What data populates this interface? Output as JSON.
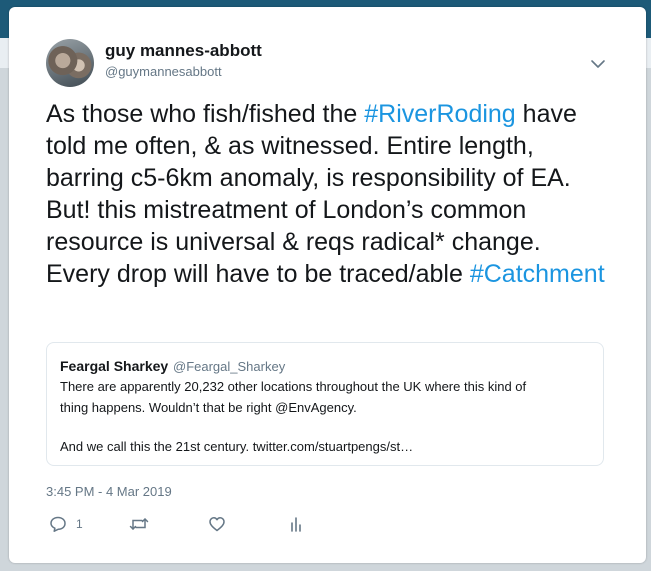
{
  "tweet": {
    "author_name": "guy mannes-abbott",
    "author_handle": "@guymannesabbott",
    "text_parts": [
      "As those who fish/fished the ",
      "#RiverRoding",
      " have told me often, & as witnessed. Entire length, barring c5-6km anomaly, is responsibility of EA. But! this mistreatment of London’s common resource is universal & reqs radical* change. Every drop will have to be traced/able ",
      "#Catchment"
    ],
    "timestamp": "3:45 PM - 4 Mar 2019",
    "reply_count": "1"
  },
  "quoted": {
    "author_name": "Feargal Sharkey",
    "author_handle": "@Feargal_Sharkey",
    "line1": "There are apparently 20,232 other locations throughout the UK where this kind of",
    "line2": "thing happens. Wouldn’t that be right @EnvAgency.",
    "line3": "And we call this the 21st century. twitter.com/stuartpengs/st…"
  },
  "icons": {
    "reply": "reply-icon",
    "retweet": "retweet-icon",
    "like": "heart-icon",
    "analytics": "analytics-icon",
    "caret": "chevron-down-icon"
  },
  "colors": {
    "link": "#1b95e0",
    "secondary_text": "#657786",
    "primary_text": "#14171a"
  }
}
